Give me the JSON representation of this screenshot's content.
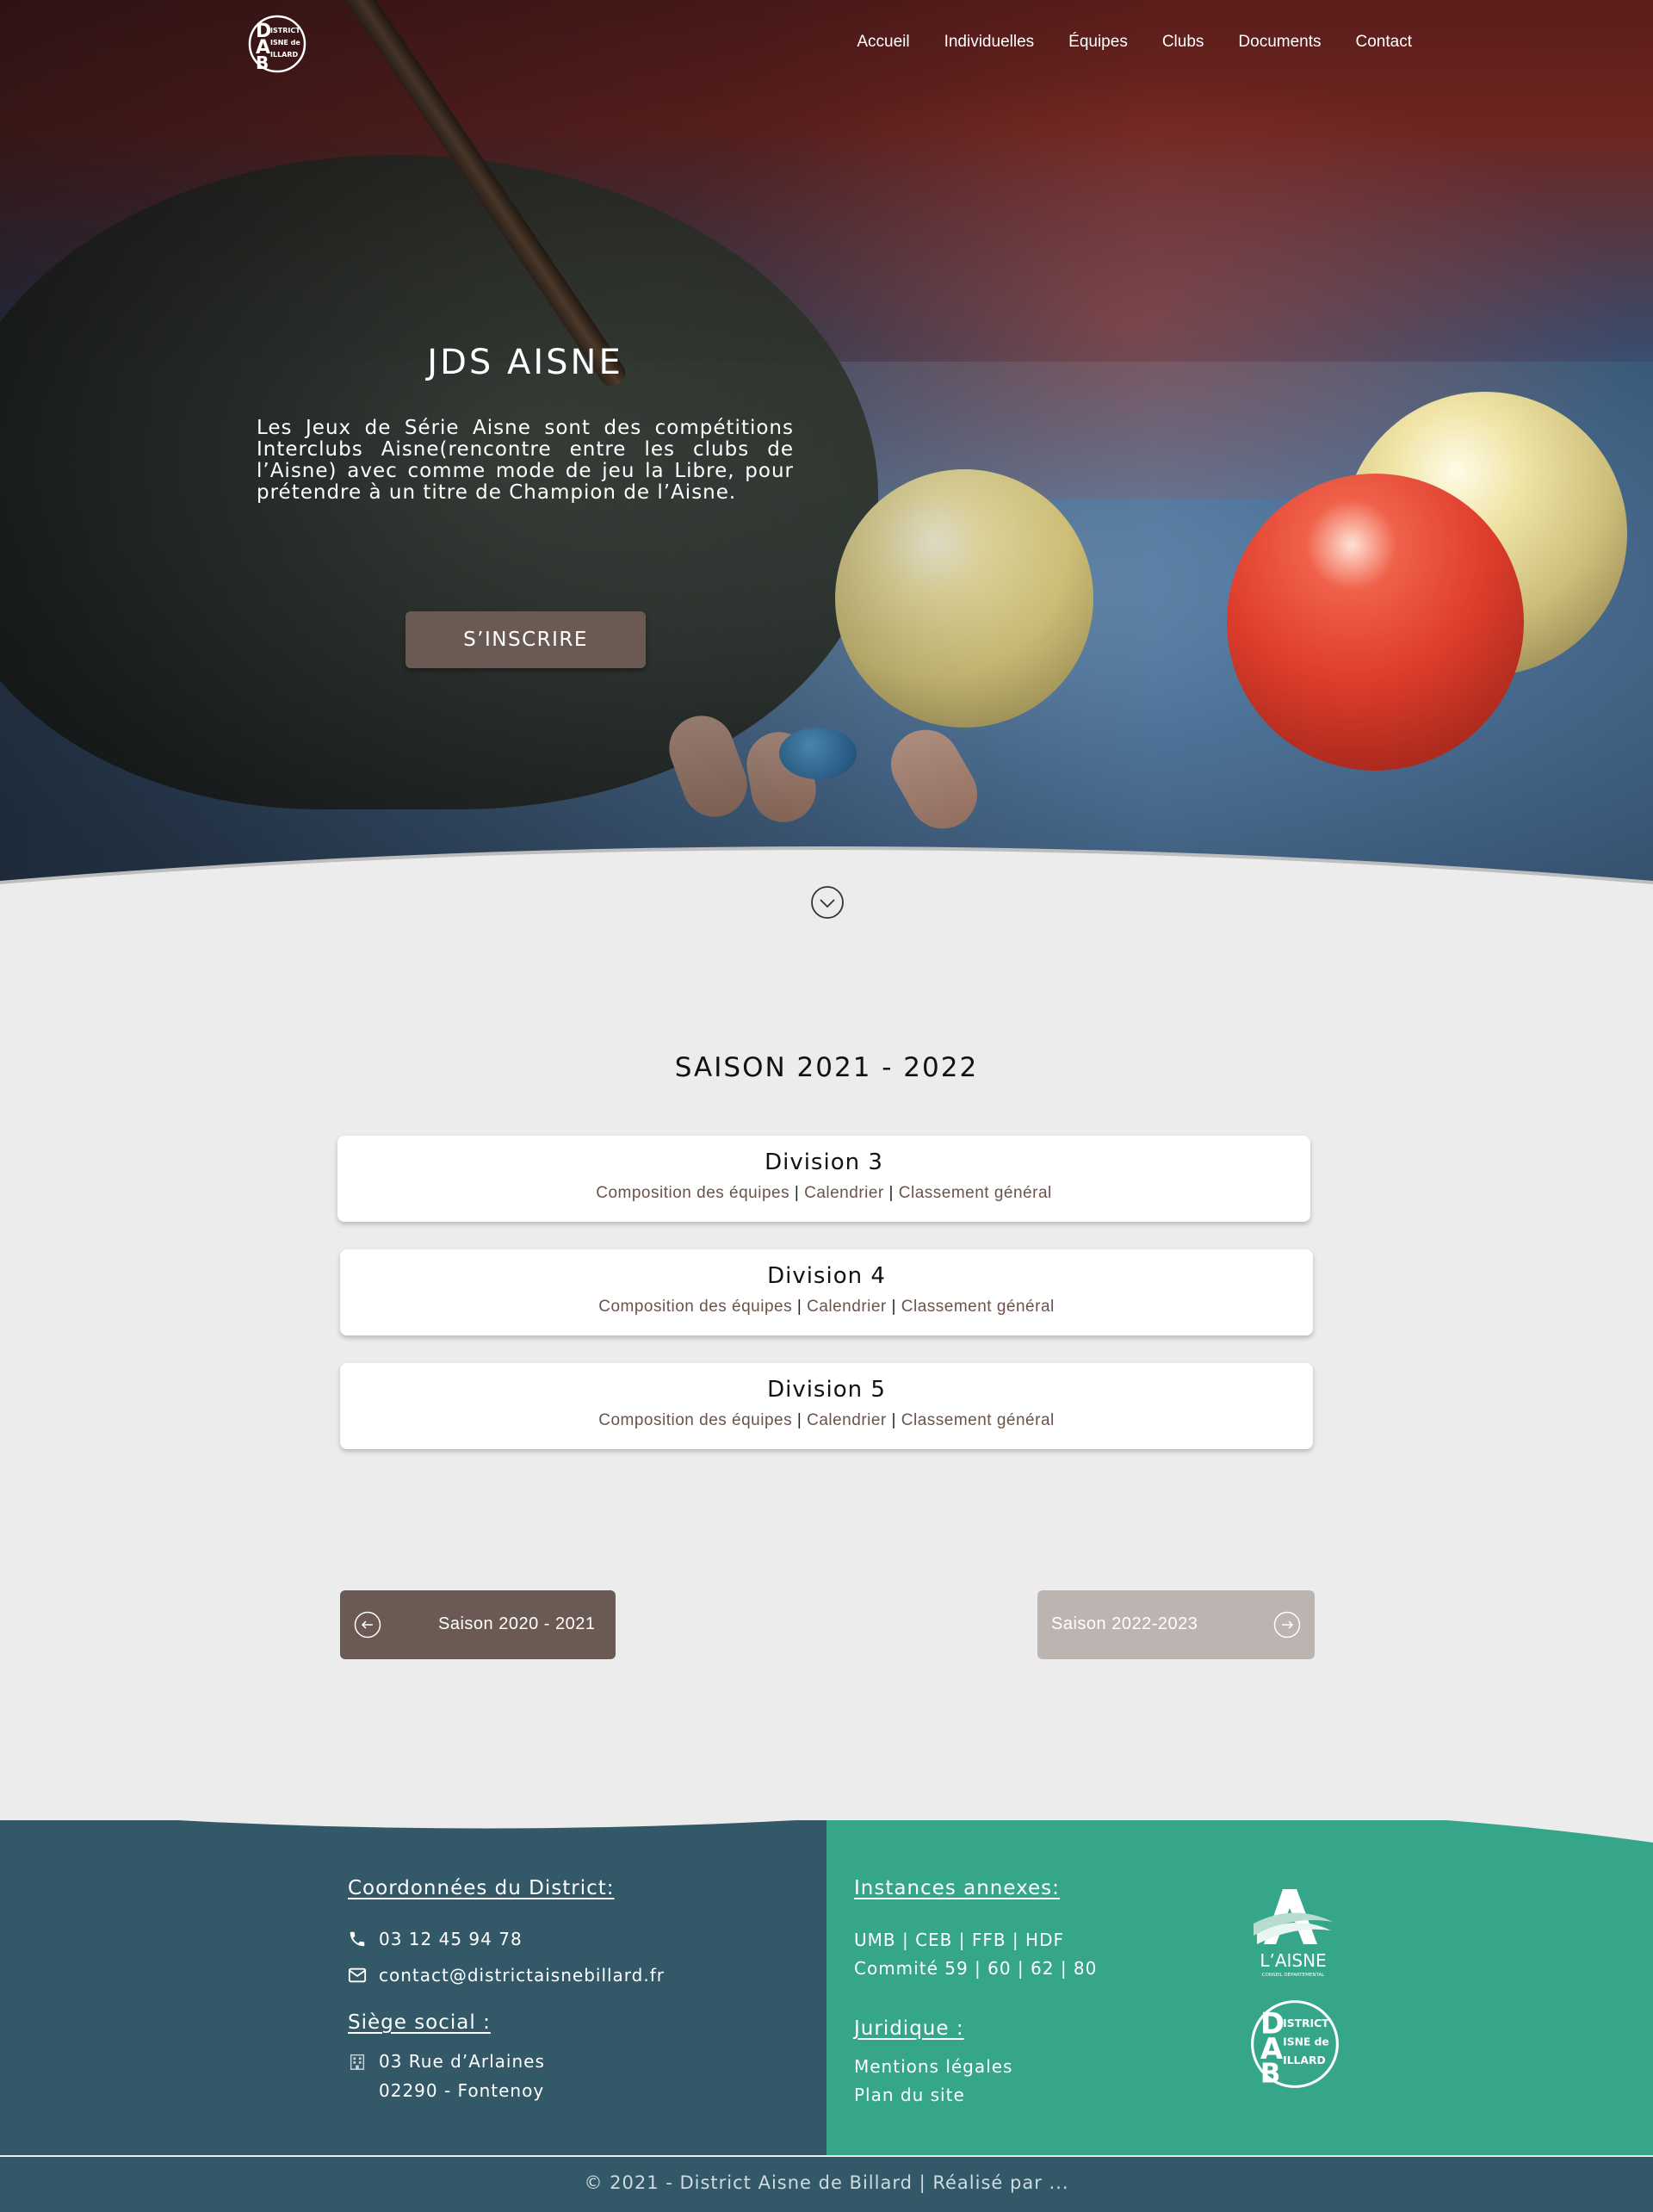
{
  "nav": {
    "items": [
      "Accueil",
      "Individuelles",
      "Équipes",
      "Clubs",
      "Documents",
      "Contact"
    ],
    "logo_text": "DISTRICT AISNE de BILLARD"
  },
  "hero": {
    "title": "JDS AISNE",
    "text": "Les Jeux de Série Aisne sont des compétitions Interclubs Aisne(rencontre entre les clubs de l’Aisne) avec comme mode de jeu la Libre, pour prétendre à un titre de Champion de l’Aisne.",
    "button": "S’INSCRIRE"
  },
  "season": {
    "title": "SAISON 2021 - 2022",
    "divisions": [
      {
        "name": "Division 3",
        "links": [
          "Composition des équipes",
          "Calendrier",
          "Classement général"
        ]
      },
      {
        "name": "Division 4",
        "links": [
          "Composition des équipes",
          "Calendrier",
          "Classement général"
        ]
      },
      {
        "name": "Division 5",
        "links": [
          "Composition des équipes",
          "Calendrier",
          "Classement général"
        ]
      }
    ],
    "separator": "|",
    "prev": "Saison 2020 - 2021",
    "next": "Saison 2022-2023"
  },
  "footer": {
    "coords_title": "Coordonnées du District:",
    "phone": "03 12 45 94 78",
    "email": "contact@districtaisnebillard.fr",
    "siege_title": "Siège social :",
    "address_line1": "03 Rue  d’Arlaines",
    "address_line2": "02290 - Fontenoy",
    "instances_title": "Instances annexes:",
    "instances_line1": "UMB | CEB | FFB | HDF",
    "instances_line2": "Commité 59 | 60 | 62 | 80",
    "juridique_title": "Juridique :",
    "mentions": "Mentions légales",
    "plan": "Plan du site",
    "aisne_logo_text": "L’AISNE",
    "aisne_logo_sub": "CONSEIL DÉPARTEMENTAL",
    "copyright": "© 2021 - District Aisne de Billard | Réalisé par ..."
  },
  "colors": {
    "accent_brown": "#6b5a54",
    "footer_blue": "#335867",
    "footer_green": "#35a689",
    "link_brown": "#6b534a"
  }
}
